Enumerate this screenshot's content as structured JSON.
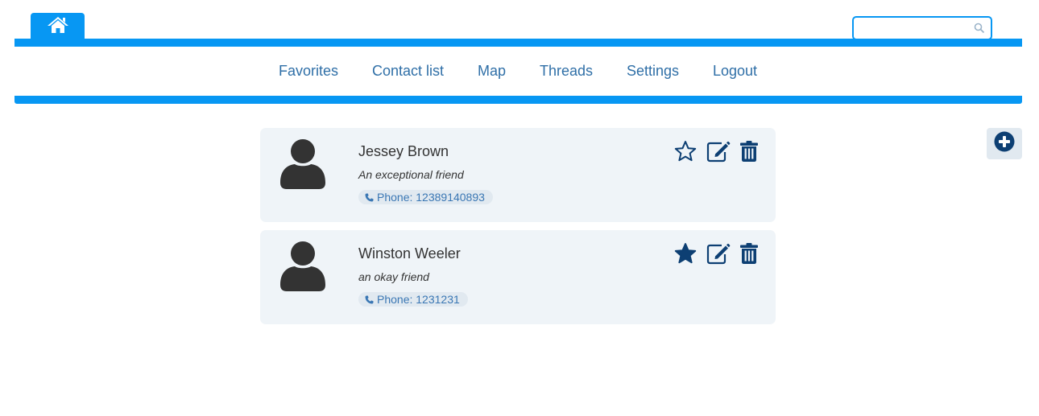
{
  "header": {
    "home_icon": "home-icon",
    "search": {
      "value": "",
      "placeholder": "",
      "icon": "search-icon"
    }
  },
  "nav": {
    "items": [
      {
        "label": "Favorites"
      },
      {
        "label": "Contact list"
      },
      {
        "label": "Map"
      },
      {
        "label": "Threads"
      },
      {
        "label": "Settings"
      },
      {
        "label": "Logout"
      }
    ]
  },
  "contacts": [
    {
      "name": "Jessey Brown",
      "description": "An exceptional friend",
      "phone": "Phone: 12389140893",
      "favorite": false
    },
    {
      "name": "Winston Weeler",
      "description": "an okay friend",
      "phone": "Phone: 1231231",
      "favorite": true
    }
  ],
  "actions": {
    "add_icon": "plus-circle-icon"
  },
  "colors": {
    "accent": "#0797f3",
    "nav_text": "#2f6fa7",
    "icon_dark": "#0d3f73",
    "card_bg": "#eff4f8",
    "avatar": "#333333"
  }
}
